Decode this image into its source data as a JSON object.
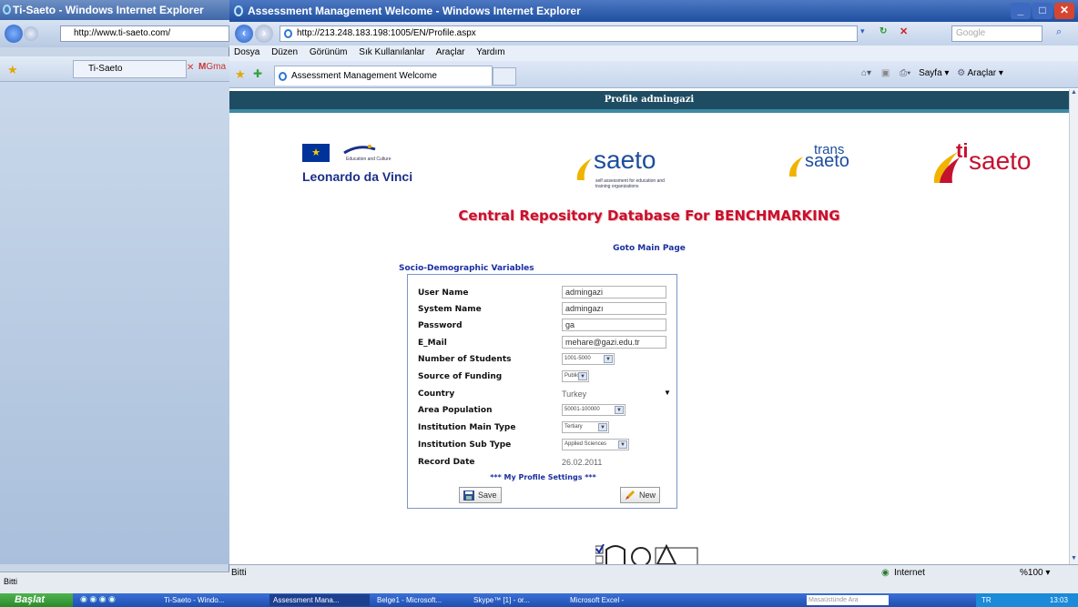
{
  "background_window": {
    "title": "Ti-Saeto - Windows Internet Explorer",
    "url": "http://www.ti-saeto.com/",
    "tab_label": "Ti-Saeto",
    "gmail_tab": "Gma",
    "status": "Bitti"
  },
  "window": {
    "title": "Assessment Management Welcome - Windows Internet Explorer",
    "url": "http://213.248.183.198:1005/EN/Profile.aspx",
    "search_placeholder": "Google",
    "menu": [
      "Dosya",
      "Düzen",
      "Görünüm",
      "Sık Kullanılanlar",
      "Araçlar",
      "Yardım"
    ],
    "tab_label": "Assessment Management Welcome",
    "tools": {
      "page": "Sayfa",
      "tools": "Araçlar"
    },
    "status_left": "Bitti",
    "zone": "Internet",
    "zoom": "%100"
  },
  "page": {
    "banner": "Profile admingazi",
    "leonardo": {
      "name": "Leonardo da Vinci",
      "small": "Education and Culture"
    },
    "saeto": {
      "word": "saeto",
      "sub": "self assessment for education and training organizations"
    },
    "trans_saeto": {
      "top": "trans",
      "word": "saeto"
    },
    "ti_saeto": {
      "ti": "ti",
      "word": "saeto"
    },
    "heading": "Central Repository Database For BENCHMARKING",
    "goto_link": "Goto Main Page",
    "section_title": "Socio-Demographic Variables",
    "form": {
      "user_name": {
        "label": "User Name",
        "value": "admingazi"
      },
      "system_name": {
        "label": "System Name",
        "value": "admingazı"
      },
      "password": {
        "label": "Password",
        "value": "ga"
      },
      "email": {
        "label": "E_Mail",
        "value": "mehare@gazi.edu.tr"
      },
      "students": {
        "label": "Number of Students",
        "value": "1001-5000"
      },
      "funding": {
        "label": "Source of Funding",
        "value": "Public"
      },
      "country": {
        "label": "Country",
        "value": "Turkey"
      },
      "population": {
        "label": "Area Population",
        "value": "50001-100000"
      },
      "main_type": {
        "label": "Institution Main Type",
        "value": "Tertiary"
      },
      "sub_type": {
        "label": "Institution Sub Type",
        "value": "Applied Sciences"
      },
      "record_date": {
        "label": "Record Date",
        "value": "26.02.2011"
      }
    },
    "settings_title": "*** My Profile Settings ***",
    "save_label": "Save",
    "new_label": "New"
  },
  "taskbar": {
    "start": "Başlat",
    "items": [
      "Ti-Saeto - Windo...",
      "Assessment Mana...",
      "Belge1 - Microsoft...",
      "Skype™ [1] - or...",
      "Microsoft Excel -"
    ],
    "search_placeholder": "Masaüstünde Ara",
    "lang": "TR",
    "clock": "13:03"
  },
  "colors": {
    "banner": "#1e4c63",
    "heading": "#c8102e",
    "link": "#1a2fa0",
    "taskbar": "#2456b8"
  }
}
